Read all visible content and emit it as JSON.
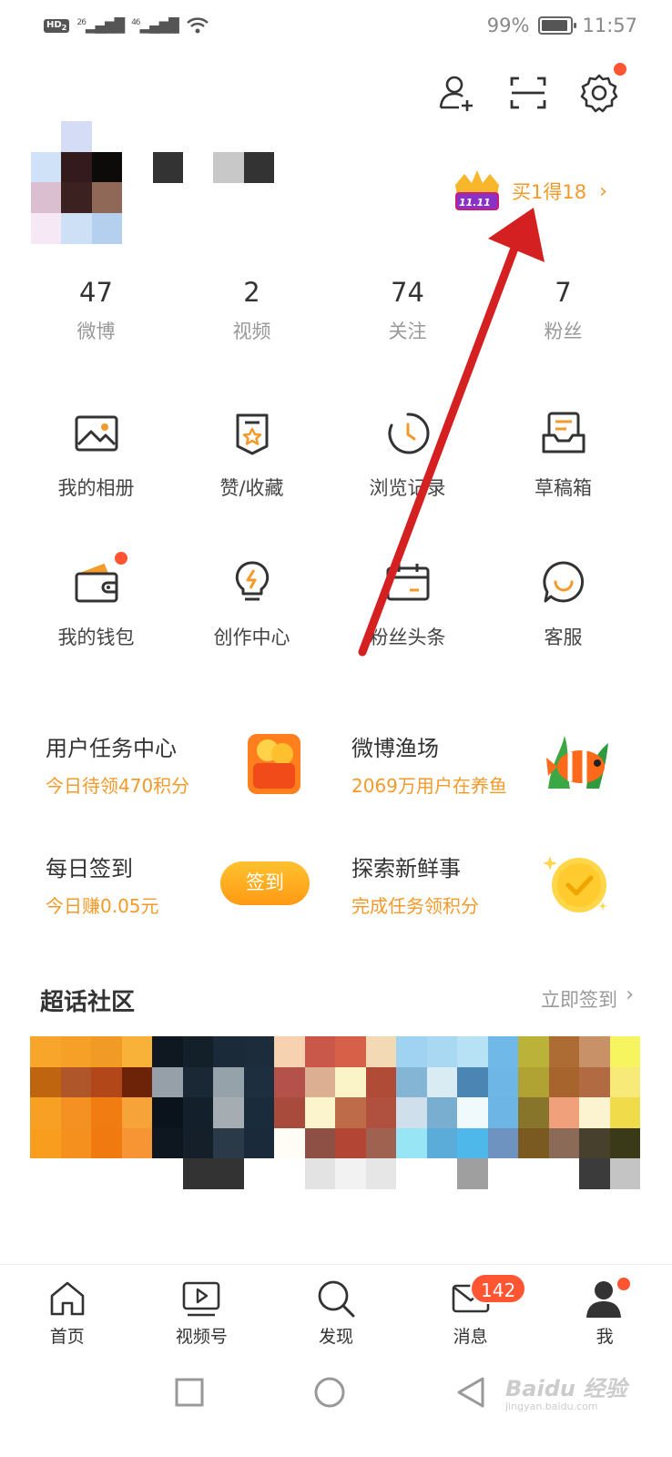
{
  "status_bar": {
    "hd": "HD",
    "hd_sub": "2",
    "net1": "26",
    "net2": "46",
    "battery": "99%",
    "time": "11:57"
  },
  "profile": {
    "promo_text": "买1得18",
    "promo_badge": "11.11"
  },
  "stats": [
    {
      "num": "47",
      "label": "微博"
    },
    {
      "num": "2",
      "label": "视频"
    },
    {
      "num": "74",
      "label": "关注"
    },
    {
      "num": "7",
      "label": "粉丝"
    }
  ],
  "menu_row1": [
    {
      "icon": "album-icon",
      "label": "我的相册"
    },
    {
      "icon": "favorite-icon",
      "label": "赞/收藏"
    },
    {
      "icon": "history-icon",
      "label": "浏览记录"
    },
    {
      "icon": "drafts-icon",
      "label": "草稿箱"
    }
  ],
  "menu_row2": [
    {
      "icon": "wallet-icon",
      "label": "我的钱包"
    },
    {
      "icon": "bulb-icon",
      "label": "创作中心"
    },
    {
      "icon": "fans-headline-icon",
      "label": "粉丝头条"
    },
    {
      "icon": "service-icon",
      "label": "客服"
    }
  ],
  "tasks": {
    "task_center": {
      "title": "用户任务中心",
      "sub": "今日待领470积分"
    },
    "fishing": {
      "title": "微博渔场",
      "sub": "2069万用户在养鱼"
    },
    "checkin": {
      "title": "每日签到",
      "sub": "今日赚0.05元",
      "button": "签到"
    },
    "explore": {
      "title": "探索新鲜事",
      "sub": "完成任务领积分"
    }
  },
  "super_topic": {
    "title": "超话社区",
    "link": "立即签到"
  },
  "tabbar": [
    {
      "icon": "home-icon",
      "label": "首页"
    },
    {
      "icon": "video-icon",
      "label": "视频号"
    },
    {
      "icon": "discover-icon",
      "label": "发现"
    },
    {
      "icon": "message-icon",
      "label": "消息"
    },
    {
      "icon": "me-icon",
      "label": "我"
    }
  ],
  "message_badge": "142",
  "watermark": {
    "main": "Baidu 经验",
    "sub": "jingyan.baidu.com"
  },
  "colors": {
    "accent": "#f39a2b",
    "badge_red": "#ff5533",
    "annotation_arrow": "#d42020"
  }
}
